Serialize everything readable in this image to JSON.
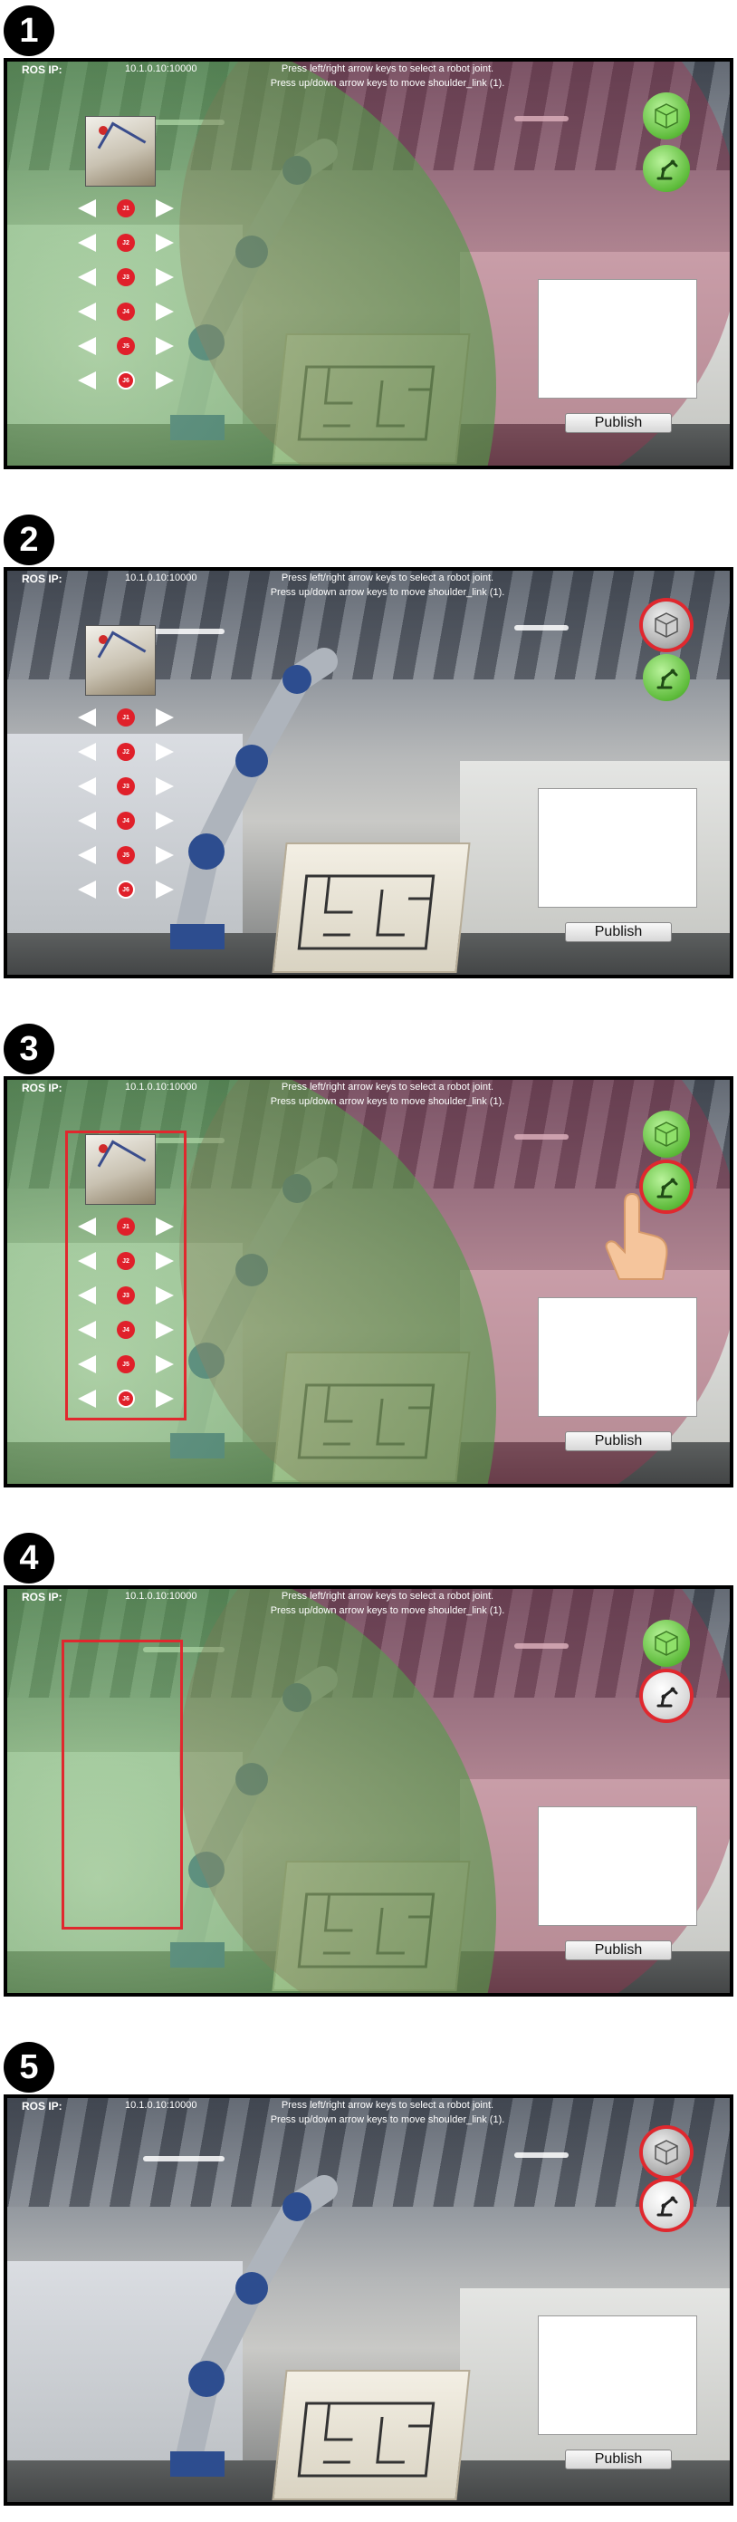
{
  "common": {
    "ros_ip_label": "ROS IP:",
    "ros_ip_value": "10.1.0.10:10000",
    "instruction_line1": "Press left/right arrow keys to select a robot joint.",
    "instruction_line2": "Press up/down arrow keys to move shoulder_link (1).",
    "publish_label": "Publish",
    "joint_labels": [
      "J1",
      "J2",
      "J3",
      "J4",
      "J5",
      "J6"
    ]
  },
  "steps": [
    {
      "number": "1"
    },
    {
      "number": "2"
    },
    {
      "number": "3"
    },
    {
      "number": "4"
    },
    {
      "number": "5"
    }
  ],
  "colors": {
    "highlight": "#e0282e",
    "joint_button": "#e0202a",
    "green_button": "#5dbb3a"
  },
  "icons": {
    "toggle_sphere_button": "cube-icon",
    "toggle_controls_button": "robot-arm-icon",
    "pointer": "hand-pointer-icon"
  }
}
